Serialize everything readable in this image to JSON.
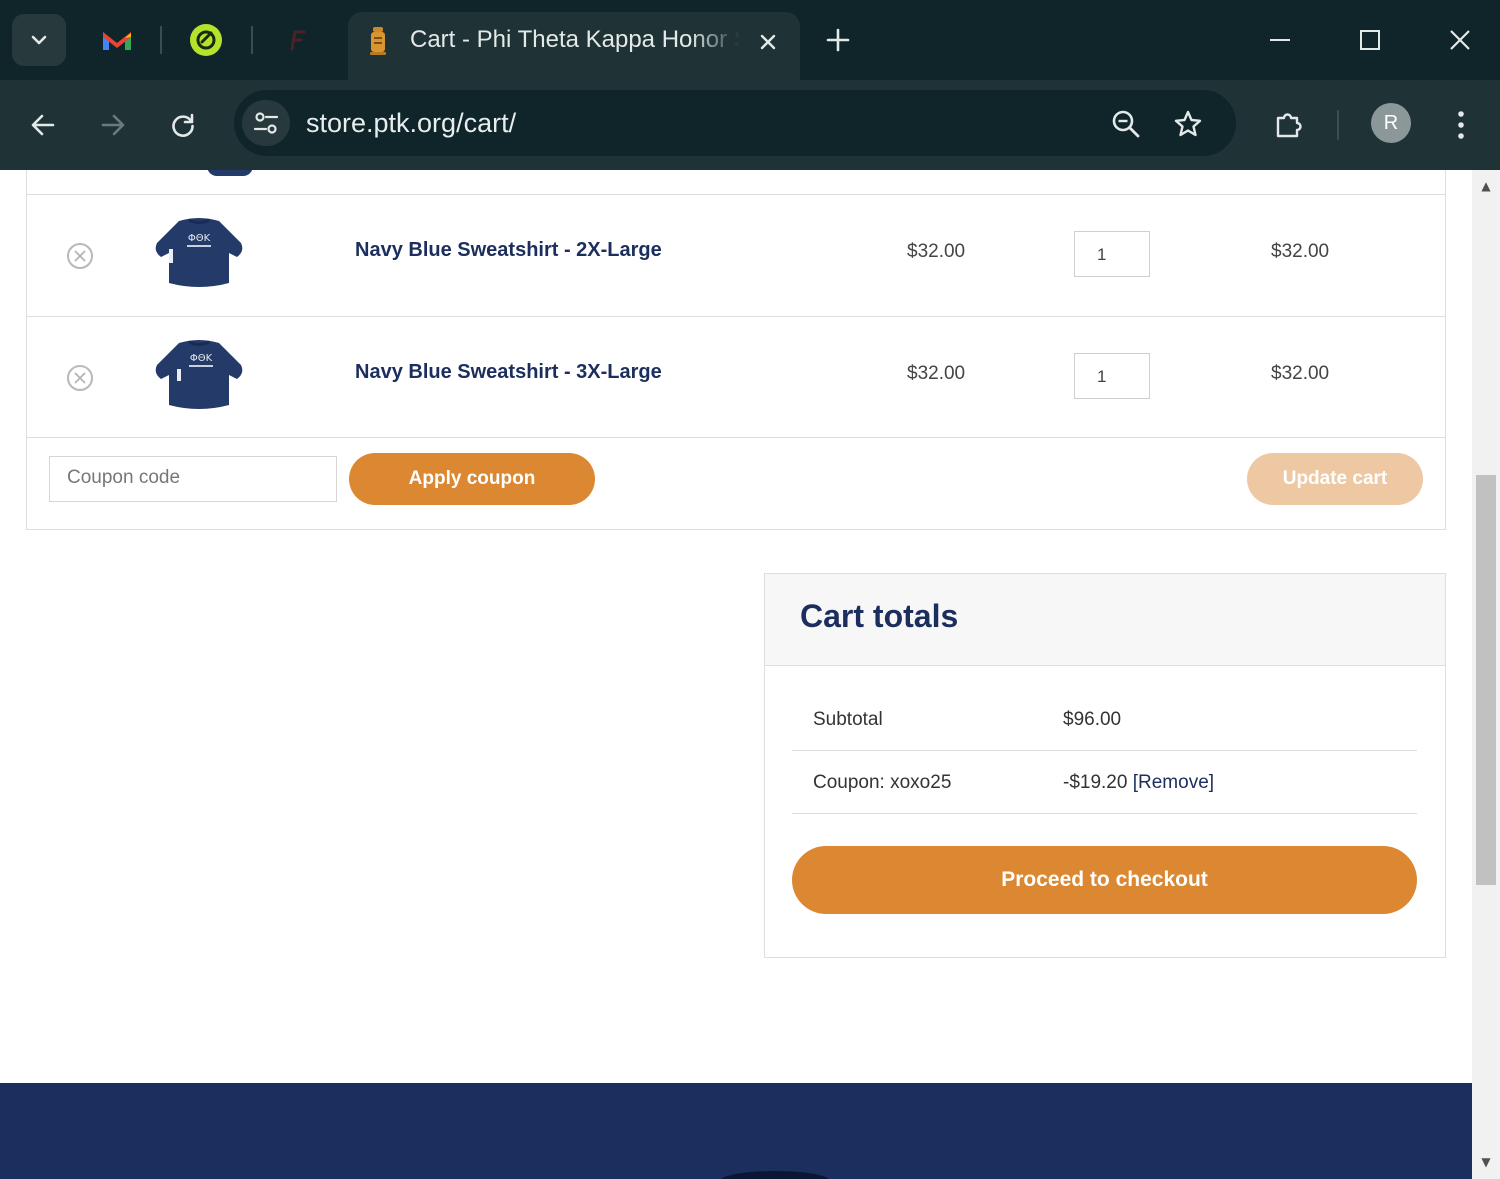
{
  "browser": {
    "active_tab_title": "Cart - Phi Theta Kappa Honor Society",
    "url": "store.ptk.org/cart/",
    "profile_initial": "R",
    "colors": {
      "tabstrip": "#0f2529",
      "toolbar": "#1f3236"
    }
  },
  "cart": {
    "items": [
      {
        "name": "Navy Blue Sweatshirt - 2X-Large",
        "price": "$32.00",
        "quantity": "1",
        "subtotal": "$32.00"
      },
      {
        "name": "Navy Blue Sweatshirt - 3X-Large",
        "price": "$32.00",
        "quantity": "1",
        "subtotal": "$32.00"
      }
    ],
    "coupon_placeholder": "Coupon code",
    "apply_coupon_label": "Apply coupon",
    "update_cart_label": "Update cart"
  },
  "totals": {
    "title": "Cart totals",
    "subtotal_label": "Subtotal",
    "subtotal_value": "$96.00",
    "coupon_label": "Coupon: xoxo25",
    "coupon_value": "-$19.20",
    "remove_label": "[Remove]",
    "checkout_label": "Proceed to checkout"
  },
  "colors": {
    "accent": "#dc8832",
    "accent_disabled": "#eec8a2",
    "navy": "#1b2e5e"
  }
}
